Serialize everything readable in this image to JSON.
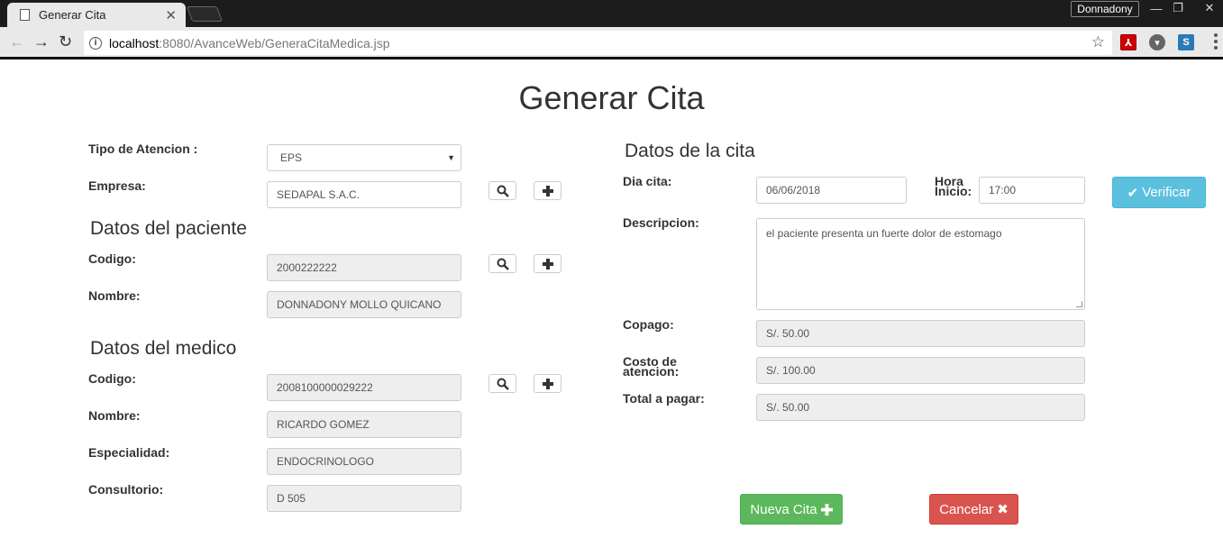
{
  "browser": {
    "tab_title": "Generar Cita",
    "profile_name": "Donnadony",
    "url_host": "localhost",
    "url_path": ":8080/AvanceWeb/GeneraCitaMedica.jsp"
  },
  "page": {
    "title": "Generar Cita"
  },
  "form_left": {
    "tipo_atencion_label": "Tipo de Atencion :",
    "tipo_atencion_value": "EPS",
    "empresa_label": "Empresa:",
    "empresa_value": "SEDAPAL S.A.C.",
    "paciente_heading": "Datos del paciente",
    "paciente_codigo_label": "Codigo:",
    "paciente_codigo_value": "2000222222",
    "paciente_nombre_label": "Nombre:",
    "paciente_nombre_value": "DONNADONY MOLLO QUICANO",
    "medico_heading": "Datos del medico",
    "medico_codigo_label": "Codigo:",
    "medico_codigo_value": "2008100000029222",
    "medico_nombre_label": "Nombre:",
    "medico_nombre_value": "RICARDO GOMEZ",
    "especialidad_label": "Especialidad:",
    "especialidad_value": "ENDOCRINOLOGO",
    "consultorio_label": "Consultorio:",
    "consultorio_value": "D 505"
  },
  "form_right": {
    "heading": "Datos de la cita",
    "dia_label": "Dia cita:",
    "dia_value": "06/06/2018",
    "hora_label_1": "Hora",
    "hora_label_2": "Inicio:",
    "hora_value": "17:00",
    "verificar_label": "Verificar",
    "descripcion_label": "Descripcion:",
    "descripcion_value": "el paciente presenta un fuerte dolor de estomago",
    "copago_label": "Copago:",
    "copago_value": "S/. 50.00",
    "costo_label_1": "Costo de",
    "costo_label_2": "atencion:",
    "costo_value": "S/. 100.00",
    "total_label": "Total a pagar:",
    "total_value": "S/. 50.00"
  },
  "actions": {
    "nueva_cita_label": "Nueva Cita",
    "cancelar_label": "Cancelar"
  },
  "colors": {
    "info": "#5bc0de",
    "success": "#5cb85c",
    "danger": "#d9534f"
  }
}
